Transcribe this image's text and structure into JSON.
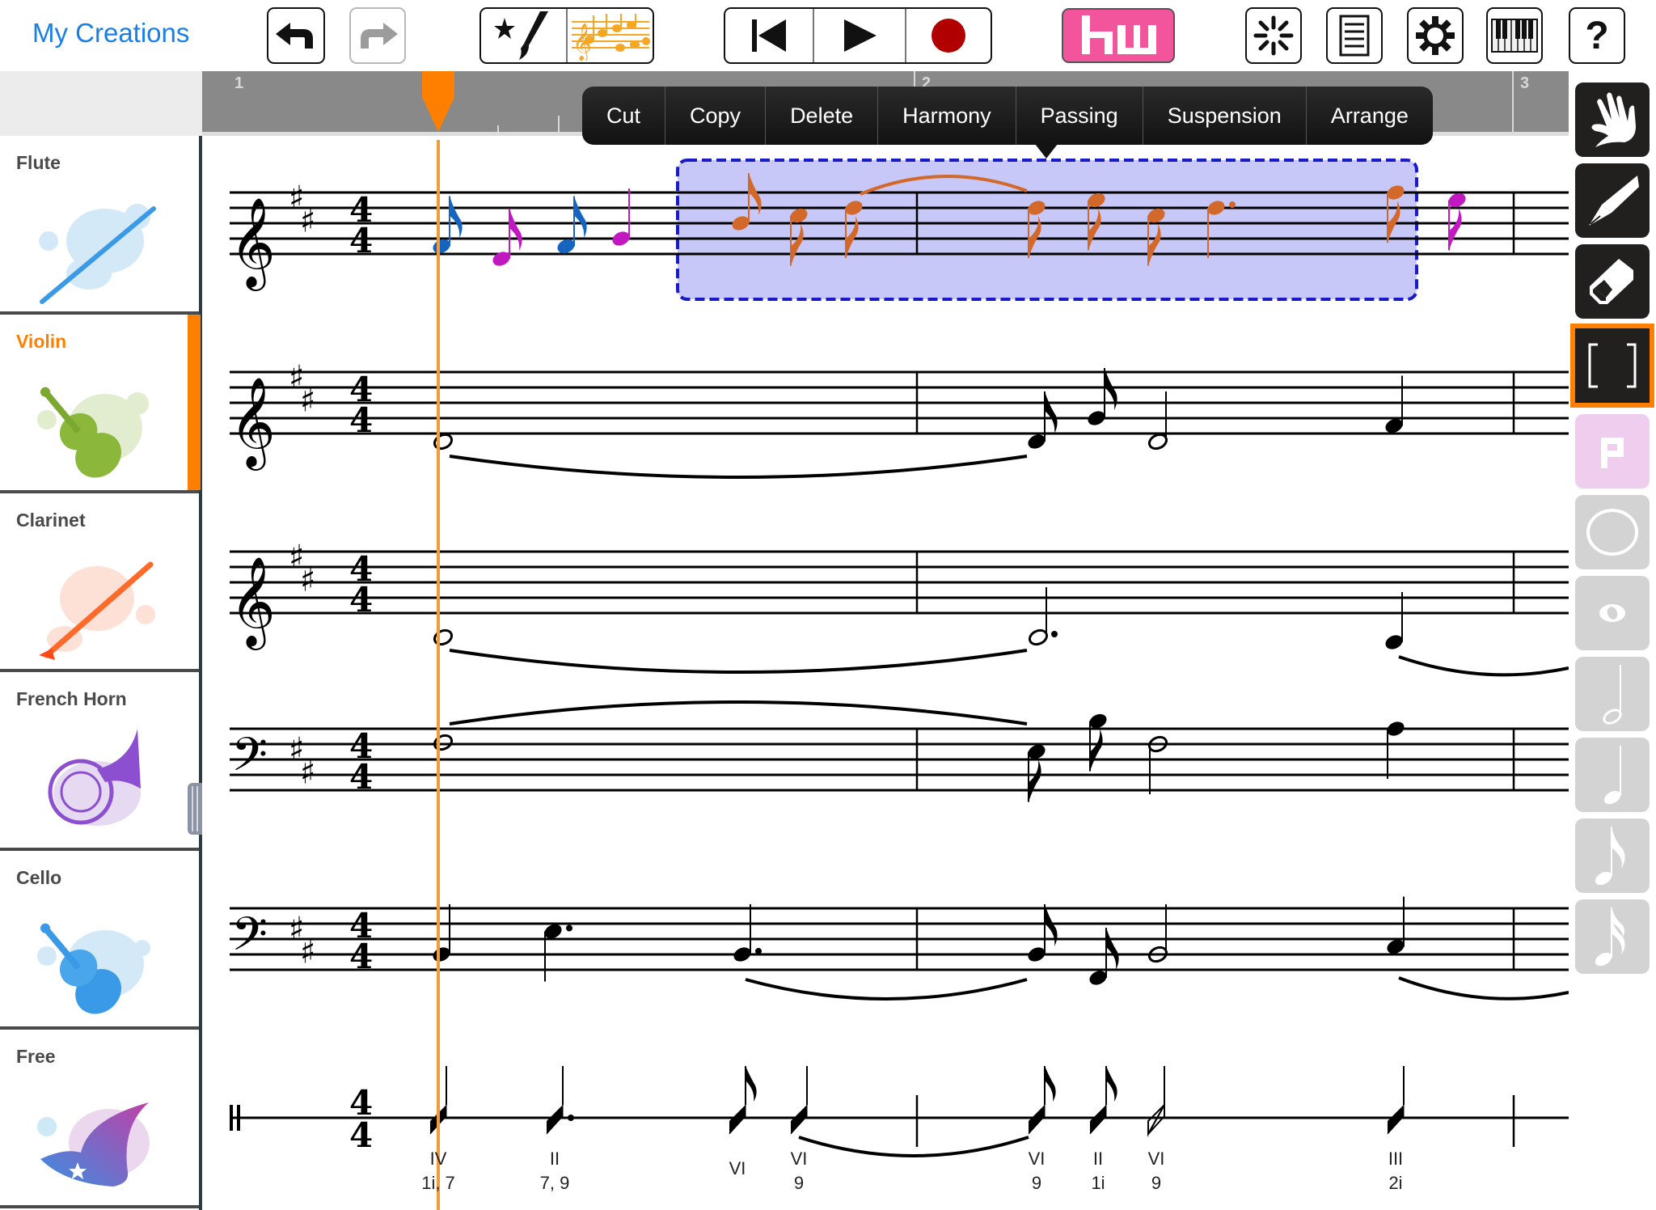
{
  "topbar": {
    "back_label": "My Creations",
    "buttons": [
      {
        "name": "undo",
        "icon": "undo-arrow-icon",
        "enabled": true
      },
      {
        "name": "redo",
        "icon": "redo-arrow-icon",
        "enabled": false
      },
      {
        "name": "style-brush",
        "icon": "star-brush-icon"
      },
      {
        "name": "score-view",
        "icon": "music-score-icon"
      },
      {
        "name": "rewind",
        "icon": "skip-to-start-icon"
      },
      {
        "name": "play",
        "icon": "play-icon"
      },
      {
        "name": "record",
        "icon": "record-icon"
      },
      {
        "name": "hw",
        "label": "hw"
      },
      {
        "name": "loading",
        "icon": "spinner-icon"
      },
      {
        "name": "sheet",
        "icon": "document-lines-icon"
      },
      {
        "name": "settings",
        "icon": "gear-icon"
      },
      {
        "name": "keyboard",
        "icon": "piano-keys-icon"
      },
      {
        "name": "help",
        "label": "?"
      }
    ]
  },
  "ruler": {
    "measures": [
      "1",
      "2",
      "3"
    ]
  },
  "context_menu": {
    "items": [
      "Cut",
      "Copy",
      "Delete",
      "Harmony",
      "Passing",
      "Suspension",
      "Arrange"
    ]
  },
  "tracks": [
    {
      "name": "Flute",
      "color": "#3a9ae8",
      "selected": false,
      "clef": "treble"
    },
    {
      "name": "Violin",
      "color": "#8bb83a",
      "selected": true,
      "clef": "treble"
    },
    {
      "name": "Clarinet",
      "color": "#ff5a22",
      "selected": false,
      "clef": "treble"
    },
    {
      "name": "French Horn",
      "color": "#8b4fcf",
      "selected": false,
      "clef": "bass"
    },
    {
      "name": "Cello",
      "color": "#3a9ae8",
      "selected": false,
      "clef": "bass"
    },
    {
      "name": "Free",
      "color": "#9b55c8",
      "selected": false,
      "clef": "percussion"
    }
  ],
  "score": {
    "key_signature": "2 sharps (D major)",
    "time_signature": "4/4",
    "selection_color": "#c8c8f8",
    "selection_border": "#1a1ac8",
    "playhead_color": "#f39a3a",
    "chord_labels": [
      {
        "roman": "IV",
        "figures": "1i, 7"
      },
      {
        "roman": "II",
        "figures": "7, 9"
      },
      {
        "roman": "VI",
        "figures": ""
      },
      {
        "roman": "VI",
        "figures": "9"
      },
      {
        "roman": "VI",
        "figures": "9"
      },
      {
        "roman": "II",
        "figures": "1i"
      },
      {
        "roman": "VI",
        "figures": "9"
      },
      {
        "roman": "III",
        "figures": "2i"
      }
    ]
  },
  "tools": [
    {
      "name": "hand",
      "icon": "hand-icon",
      "state": "normal"
    },
    {
      "name": "pen",
      "icon": "pen-icon",
      "state": "normal"
    },
    {
      "name": "eraser",
      "icon": "eraser-icon",
      "state": "normal"
    },
    {
      "name": "select",
      "icon": "bracket-select-icon",
      "state": "active"
    },
    {
      "name": "pedal",
      "icon": "p-block-icon",
      "state": "disabled"
    },
    {
      "name": "circle",
      "icon": "circle-icon",
      "state": "disabled"
    },
    {
      "name": "whole-note",
      "icon": "whole-note-icon",
      "state": "disabled"
    },
    {
      "name": "half-note",
      "icon": "half-note-icon",
      "state": "disabled"
    },
    {
      "name": "quarter-note",
      "icon": "quarter-note-icon",
      "state": "disabled"
    },
    {
      "name": "eighth-note",
      "icon": "eighth-note-icon",
      "state": "disabled"
    },
    {
      "name": "sixteenth-note",
      "icon": "sixteenth-note-icon",
      "state": "disabled"
    }
  ]
}
